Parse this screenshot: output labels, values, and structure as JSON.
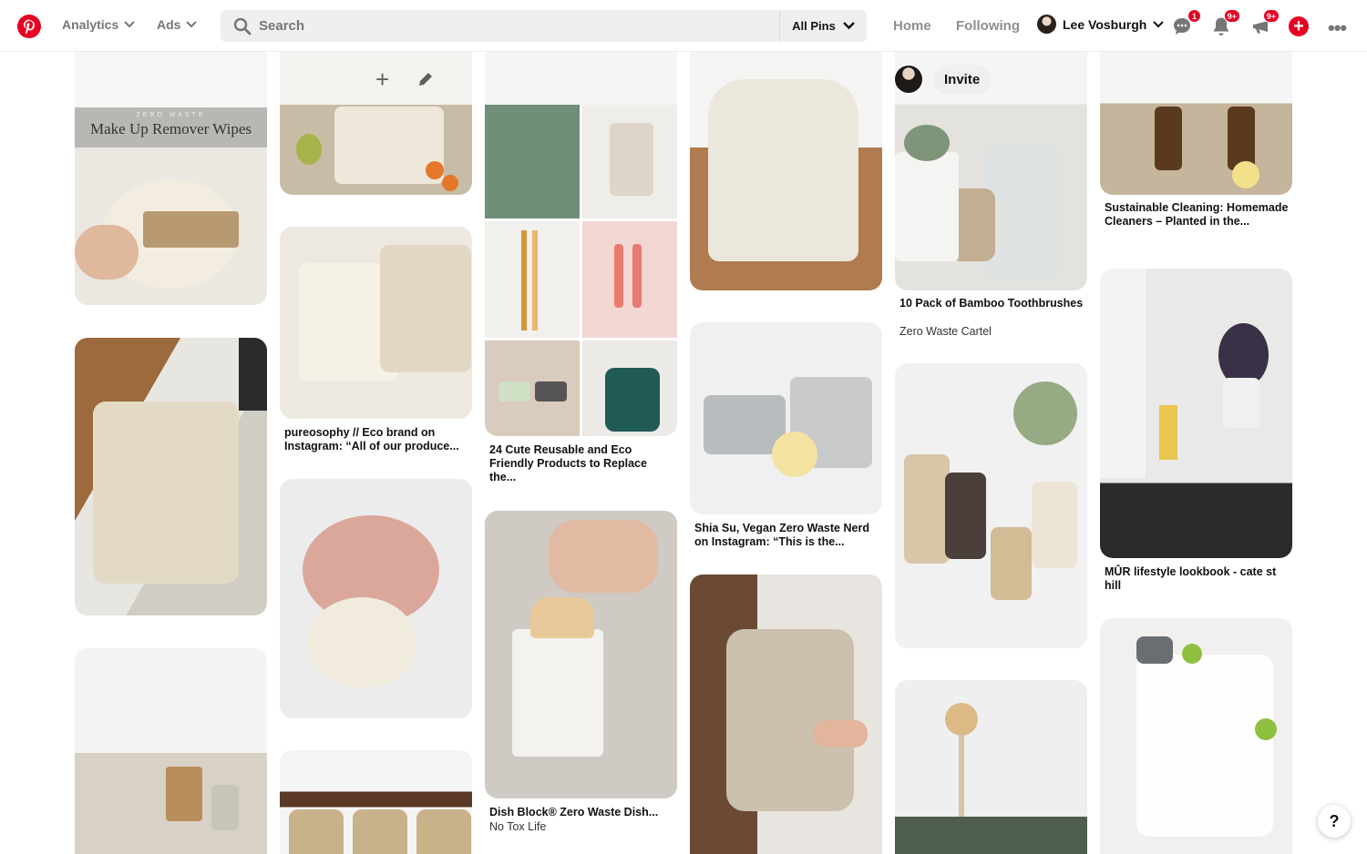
{
  "header": {
    "nav_analytics": "Analytics",
    "nav_ads": "Ads",
    "search_placeholder": "Search",
    "search_scope": "All Pins",
    "nav_home": "Home",
    "nav_following": "Following",
    "user_name": "Lee Vosburgh",
    "messages_badge": "1",
    "notifications_badge": "9+",
    "updates_badge": "9+",
    "accent_color": "#e60023"
  },
  "overlay": {
    "invite_label": "Invite"
  },
  "banner": {
    "small": "ZERO WASTE",
    "title": "Make Up Remover Wipes"
  },
  "pins": {
    "pureosophy": "pureosophy // Eco brand on Instagram: “All of our produce...",
    "cute24": "24 Cute Reusable and Eco Friendly Products to Replace the...",
    "shia": "Shia Su, Vegan Zero Waste Nerd on Instagram: “This is the...",
    "dish_title": "Dish Block® Zero Waste Dish...",
    "dish_sub": "No Tox Life",
    "bamboo_title": "10 Pack of Bamboo Toothbrushes",
    "bamboo_sub": "Zero Waste Cartel",
    "cleaning": "Sustainable Cleaning: Homemade Cleaners – Planted in the...",
    "mur": "MÛR lifestyle lookbook - cate st hill"
  },
  "help_label": "?"
}
